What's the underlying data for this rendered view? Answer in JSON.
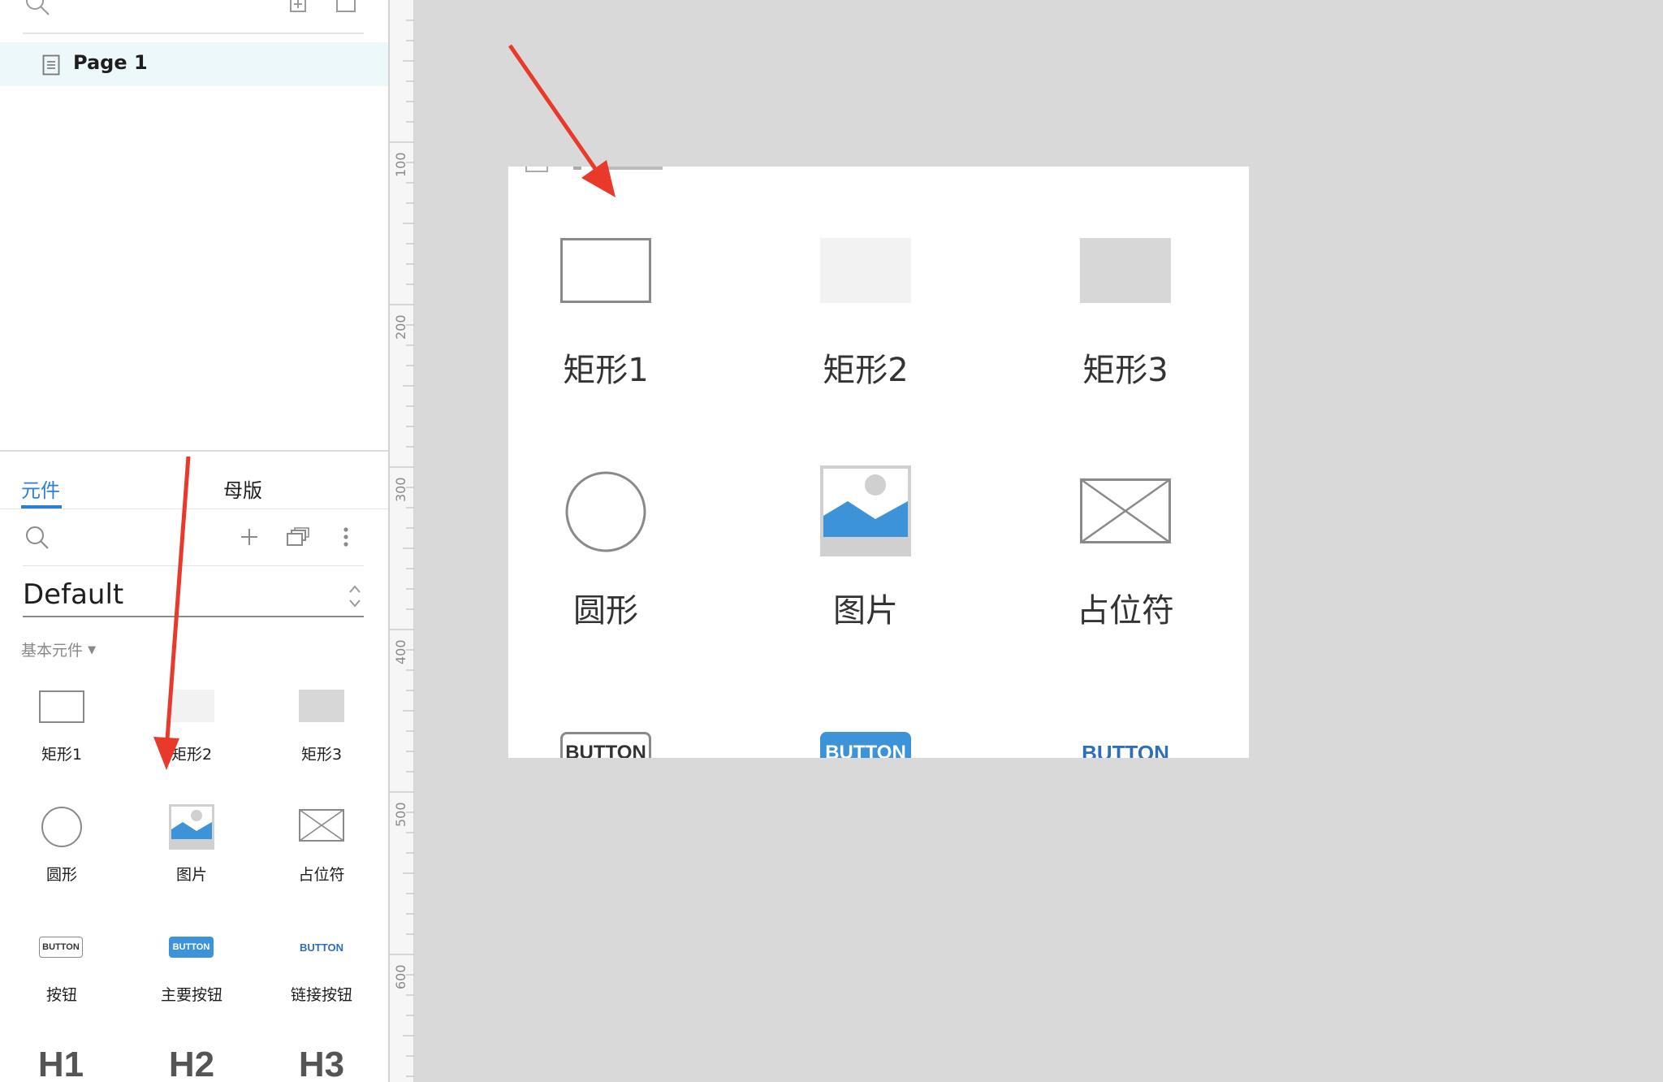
{
  "pages_panel": {
    "page_label": "Page 1"
  },
  "library_panel": {
    "tabs": [
      "元件",
      "母版"
    ],
    "library_name": "Default",
    "category": "基本元件",
    "widgets": {
      "rect1": "矩形1",
      "rect2": "矩形2",
      "rect3": "矩形3",
      "circle": "圆形",
      "image": "图片",
      "placeholder": "占位符",
      "button": "按钮",
      "primary_button": "主要按钮",
      "link_button": "链接按钮",
      "h1": "H1",
      "h2": "H2",
      "h3": "H3",
      "button_text": "BUTTON"
    }
  },
  "ruler": {
    "marks": [
      "100",
      "200",
      "300",
      "400",
      "500",
      "600"
    ]
  },
  "canvas": {
    "labels": {
      "rect1": "矩形1",
      "rect2": "矩形2",
      "rect3": "矩形3",
      "circle": "圆形",
      "image": "图片",
      "placeholder": "占位符"
    },
    "button_text": "BUTTON"
  },
  "colors": {
    "accent": "#2f7fd1",
    "annotation_arrow": "#e8392b",
    "selected_page_bg": "#edf8fb",
    "canvas_bg": "#d9d9d9"
  },
  "icons": [
    "search-icon",
    "add-page-icon",
    "add-folder-icon",
    "page-icon",
    "plus-icon",
    "copy-icon",
    "more-icon",
    "chevron-updown-icon"
  ]
}
